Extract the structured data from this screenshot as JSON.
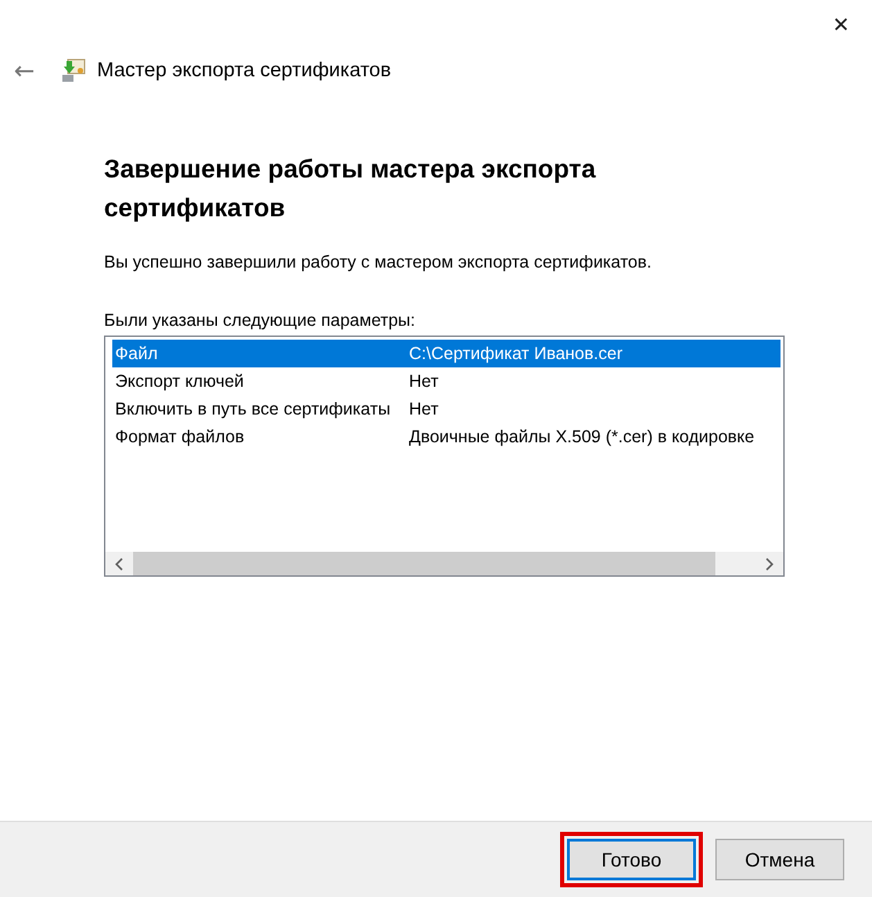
{
  "window": {
    "title": "Мастер экспорта сертификатов",
    "close": "✕",
    "back": "←"
  },
  "heading": "Завершение работы мастера экспорта сертификатов",
  "description": "Вы успешно завершили работу с мастером экспорта сертификатов.",
  "list_label": "Были указаны следующие параметры:",
  "rows": [
    {
      "name": "Файл",
      "value": "C:\\Сертификат Иванов.cer",
      "selected": true
    },
    {
      "name": "Экспорт ключей",
      "value": "Нет",
      "selected": false
    },
    {
      "name": "Включить в путь все сертификаты",
      "value": "Нет",
      "selected": false
    },
    {
      "name": "Формат файлов",
      "value": "Двоичные файлы X.509 (*.cer) в кодировке",
      "selected": false
    }
  ],
  "buttons": [
    {
      "label": "Готово",
      "highlighted": true,
      "default": true
    },
    {
      "label": "Отмена",
      "highlighted": false,
      "default": false
    }
  ]
}
